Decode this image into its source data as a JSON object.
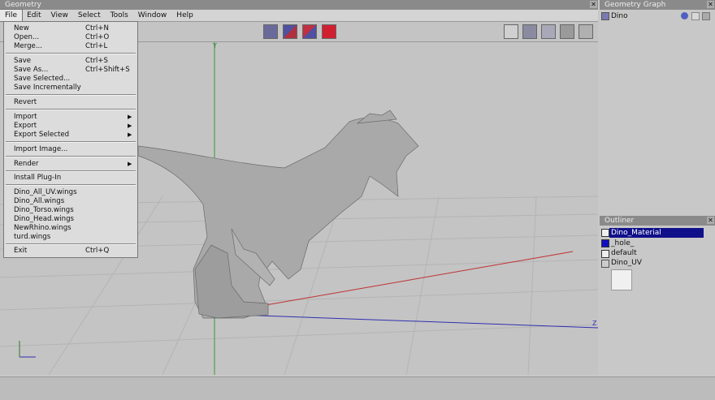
{
  "window": {
    "title": "Geometry",
    "close_glyph": "✕"
  },
  "menubar": [
    "File",
    "Edit",
    "View",
    "Select",
    "Tools",
    "Window",
    "Help"
  ],
  "file_menu": {
    "items": [
      {
        "label": "New",
        "shortcut": "Ctrl+N"
      },
      {
        "label": "Open...",
        "shortcut": "Ctrl+O"
      },
      {
        "label": "Merge...",
        "shortcut": "Ctrl+L"
      },
      {
        "label": "Save",
        "shortcut": "Ctrl+S"
      },
      {
        "label": "Save As...",
        "shortcut": "Ctrl+Shift+S"
      },
      {
        "label": "Save Selected...",
        "shortcut": ""
      },
      {
        "label": "Save Incrementally",
        "shortcut": ""
      },
      {
        "label": "Revert",
        "shortcut": ""
      },
      {
        "label": "Import",
        "shortcut": "",
        "submenu": true
      },
      {
        "label": "Export",
        "shortcut": "",
        "submenu": true
      },
      {
        "label": "Export Selected",
        "shortcut": "",
        "submenu": true
      },
      {
        "label": "Import Image...",
        "shortcut": ""
      },
      {
        "label": "Render",
        "shortcut": "",
        "submenu": true
      },
      {
        "label": "Install Plug-In",
        "shortcut": ""
      },
      {
        "label": "Dino_All_UV.wings",
        "shortcut": ""
      },
      {
        "label": "Dino_All.wings",
        "shortcut": ""
      },
      {
        "label": "Dino_Torso.wings",
        "shortcut": ""
      },
      {
        "label": "Dino_Head.wings",
        "shortcut": ""
      },
      {
        "label": "NewRhino.wings",
        "shortcut": ""
      },
      {
        "label": "turd.wings",
        "shortcut": ""
      },
      {
        "label": "Exit",
        "shortcut": "Ctrl+Q"
      }
    ]
  },
  "viewport": {
    "y_axis_label": "Y",
    "z_axis_label": "Z"
  },
  "geometry_graph": {
    "title": "Geometry Graph",
    "item": "Dino"
  },
  "outliner": {
    "title": "Outliner",
    "items": [
      "Dino_Material",
      "_hole_",
      "default",
      "Dino_UV"
    ],
    "selected_color": "#10108a"
  },
  "icons": {
    "toolbar_left": [
      "cube-blue-icon",
      "cube-blue-red-icon",
      "cube-red-blue-icon",
      "cube-red-icon"
    ],
    "toolbar_right": [
      "workmode-icon",
      "smooth-shading-icon",
      "wireframe-icon",
      "ground-plane-icon",
      "axes-icon"
    ]
  }
}
